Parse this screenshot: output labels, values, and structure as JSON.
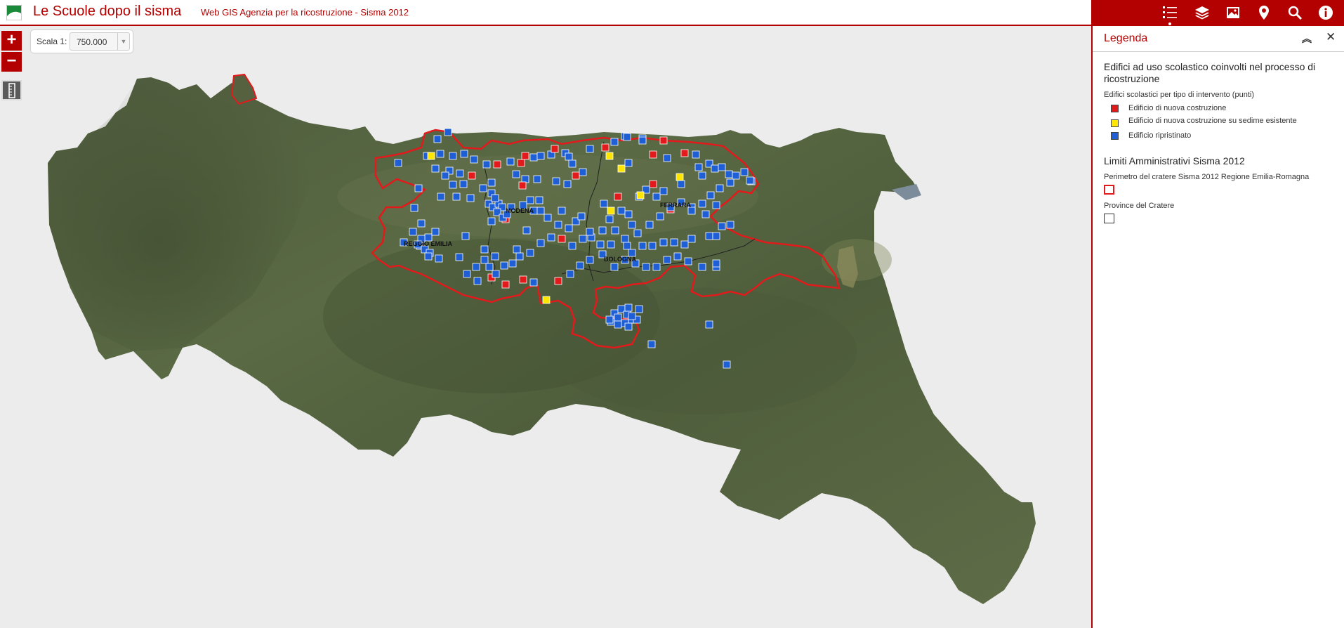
{
  "header": {
    "title": "Le Scuole dopo il sisma",
    "subtitle": "Web GIS Agenzia per la ricostruzione - Sisma 2012"
  },
  "toolbar": {
    "icons": [
      "legend-list-icon",
      "layers-icon",
      "basemap-gallery-icon",
      "location-pin-icon",
      "search-icon",
      "info-icon"
    ],
    "active": "legend-list-icon"
  },
  "map_controls": {
    "zoom_in": "+",
    "zoom_out": "−",
    "scale_label": "Scala 1:",
    "scale_value": "750.000"
  },
  "map_labels": [
    "MODENA",
    "FERRARA",
    "REGGIO EMILIA",
    "BOLOGNA"
  ],
  "legend": {
    "title": "Legenda",
    "groups": [
      {
        "title": "Edifici ad uso scolastico coinvolti nel processo di ricostruzione",
        "layer": "Edifici scolastici per tipo di intervento (punti)",
        "items": [
          {
            "label": "Edificio di nuova costruzione",
            "color": "#e31a1c"
          },
          {
            "label": "Edificio di nuova costruzione su sedime esistente",
            "color": "#ffe600"
          },
          {
            "label": "Edificio ripristinato",
            "color": "#1f5fd6"
          }
        ]
      },
      {
        "title": "Limiti Amministrativi Sisma 2012",
        "layers": [
          {
            "label": "Perimetro del cratere Sisma 2012 Regione Emilia-Romagna",
            "color": "#e31a1c"
          },
          {
            "label": "Province del Cratere",
            "color": "#333333"
          }
        ]
      }
    ]
  },
  "colors": {
    "brand": "#b30000",
    "nuova": "#e31a1c",
    "sedime": "#ffe600",
    "ripristinato": "#1f5fd6"
  }
}
